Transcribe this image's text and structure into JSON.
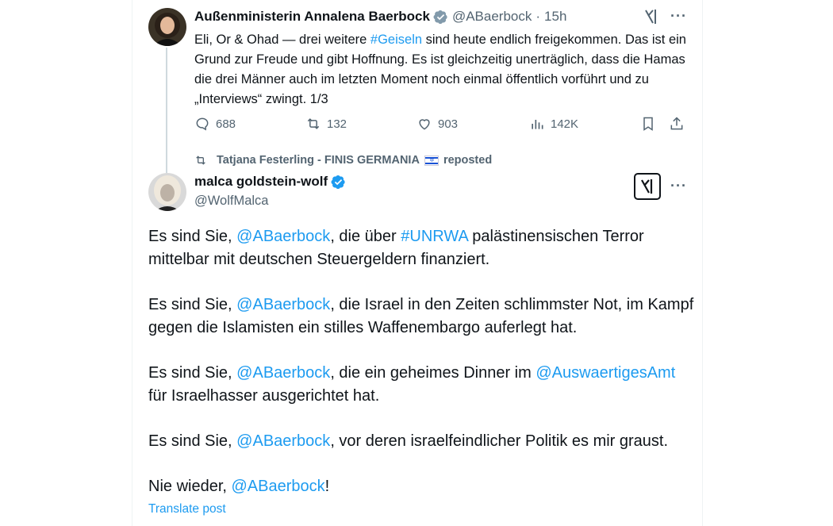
{
  "tweet1": {
    "author_name": "Außenministerin Annalena Baerbock",
    "handle": "@ABaerbock",
    "separator": "·",
    "time": "15h",
    "text_parts": [
      "Eli, Or & Ohad — drei weitere ",
      "#Geiseln",
      " sind heute endlich freigekommen. Das ist ein Grund zur Freude und gibt Hoffnung. Es ist gleichzeitig unerträglich, dass die Hamas die drei Männer auch im letzten Moment noch einmal öffentlich vorführt und zu „Interviews“ zwingt. 1/3"
    ],
    "replies": "688",
    "reposts": "132",
    "likes": "903",
    "views": "142K"
  },
  "repost_banner": {
    "user": "Tatjana Festerling - FINIS GERMANIA",
    "flag_icon": "israel-flag",
    "suffix": "reposted"
  },
  "tweet2": {
    "author_name": "malca goldstein-wolf",
    "handle": "@WolfMalca",
    "paragraphs": [
      [
        "Es sind Sie, ",
        "@ABaerbock",
        ", die über ",
        "#UNRWA",
        " palästinensischen Terror mittelbar mit deutschen Steuergeldern finanziert."
      ],
      [
        "Es sind Sie, ",
        "@ABaerbock",
        ", die Israel in den Zeiten schlimmster Not, im Kampf gegen die Islamisten ein stilles Waffenembargo auferlegt hat."
      ],
      [
        "Es sind Sie, ",
        "@ABaerbock",
        ", die ein geheimes Dinner im ",
        "@AuswaertigesAmt",
        " für Israelhasser ausgerichtet hat."
      ],
      [
        "Es sind Sie, ",
        "@ABaerbock",
        ", vor deren israelfeindlicher Politik es mir graust."
      ],
      [
        "Nie wieder, ",
        "@ABaerbock",
        "!"
      ]
    ],
    "translate_label": "Translate post"
  },
  "colors": {
    "link": "#1d9bf0",
    "secondary_text": "#536471",
    "verified": "#1d9bf0"
  }
}
